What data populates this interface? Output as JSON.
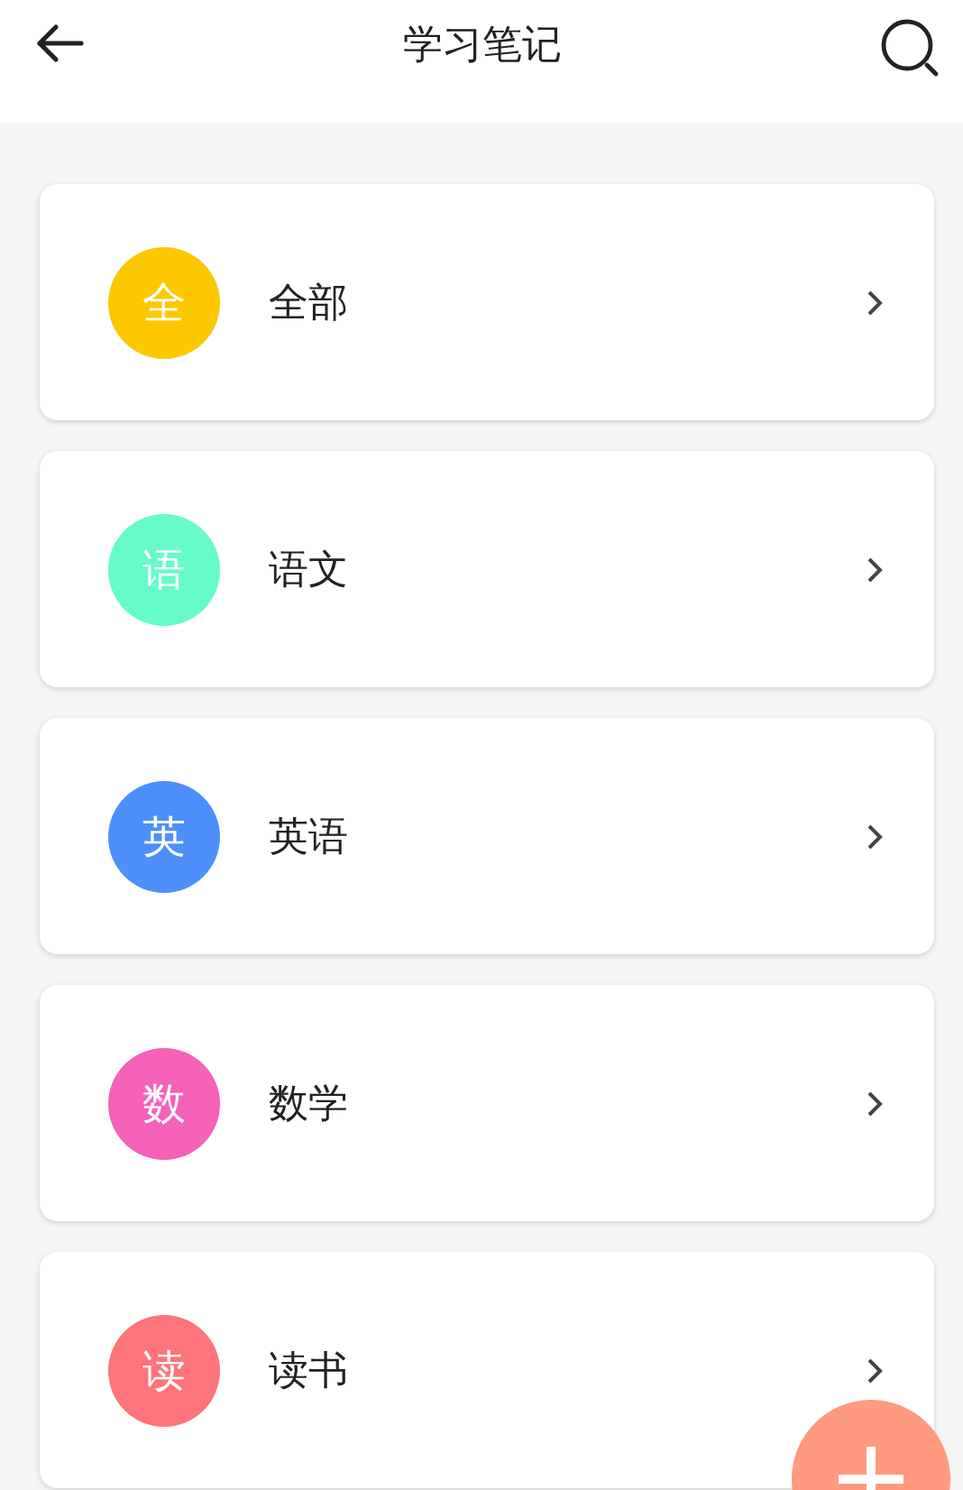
{
  "header": {
    "title": "学习笔记"
  },
  "categories": [
    {
      "badge": "全",
      "label": "全部",
      "color": "#fdc800"
    },
    {
      "badge": "语",
      "label": "语文",
      "color": "#66fbc9"
    },
    {
      "badge": "英",
      "label": "英语",
      "color": "#4d90fb"
    },
    {
      "badge": "数",
      "label": "数学",
      "color": "#f562b8"
    },
    {
      "badge": "读",
      "label": "读书",
      "color": "#fd747a"
    }
  ]
}
